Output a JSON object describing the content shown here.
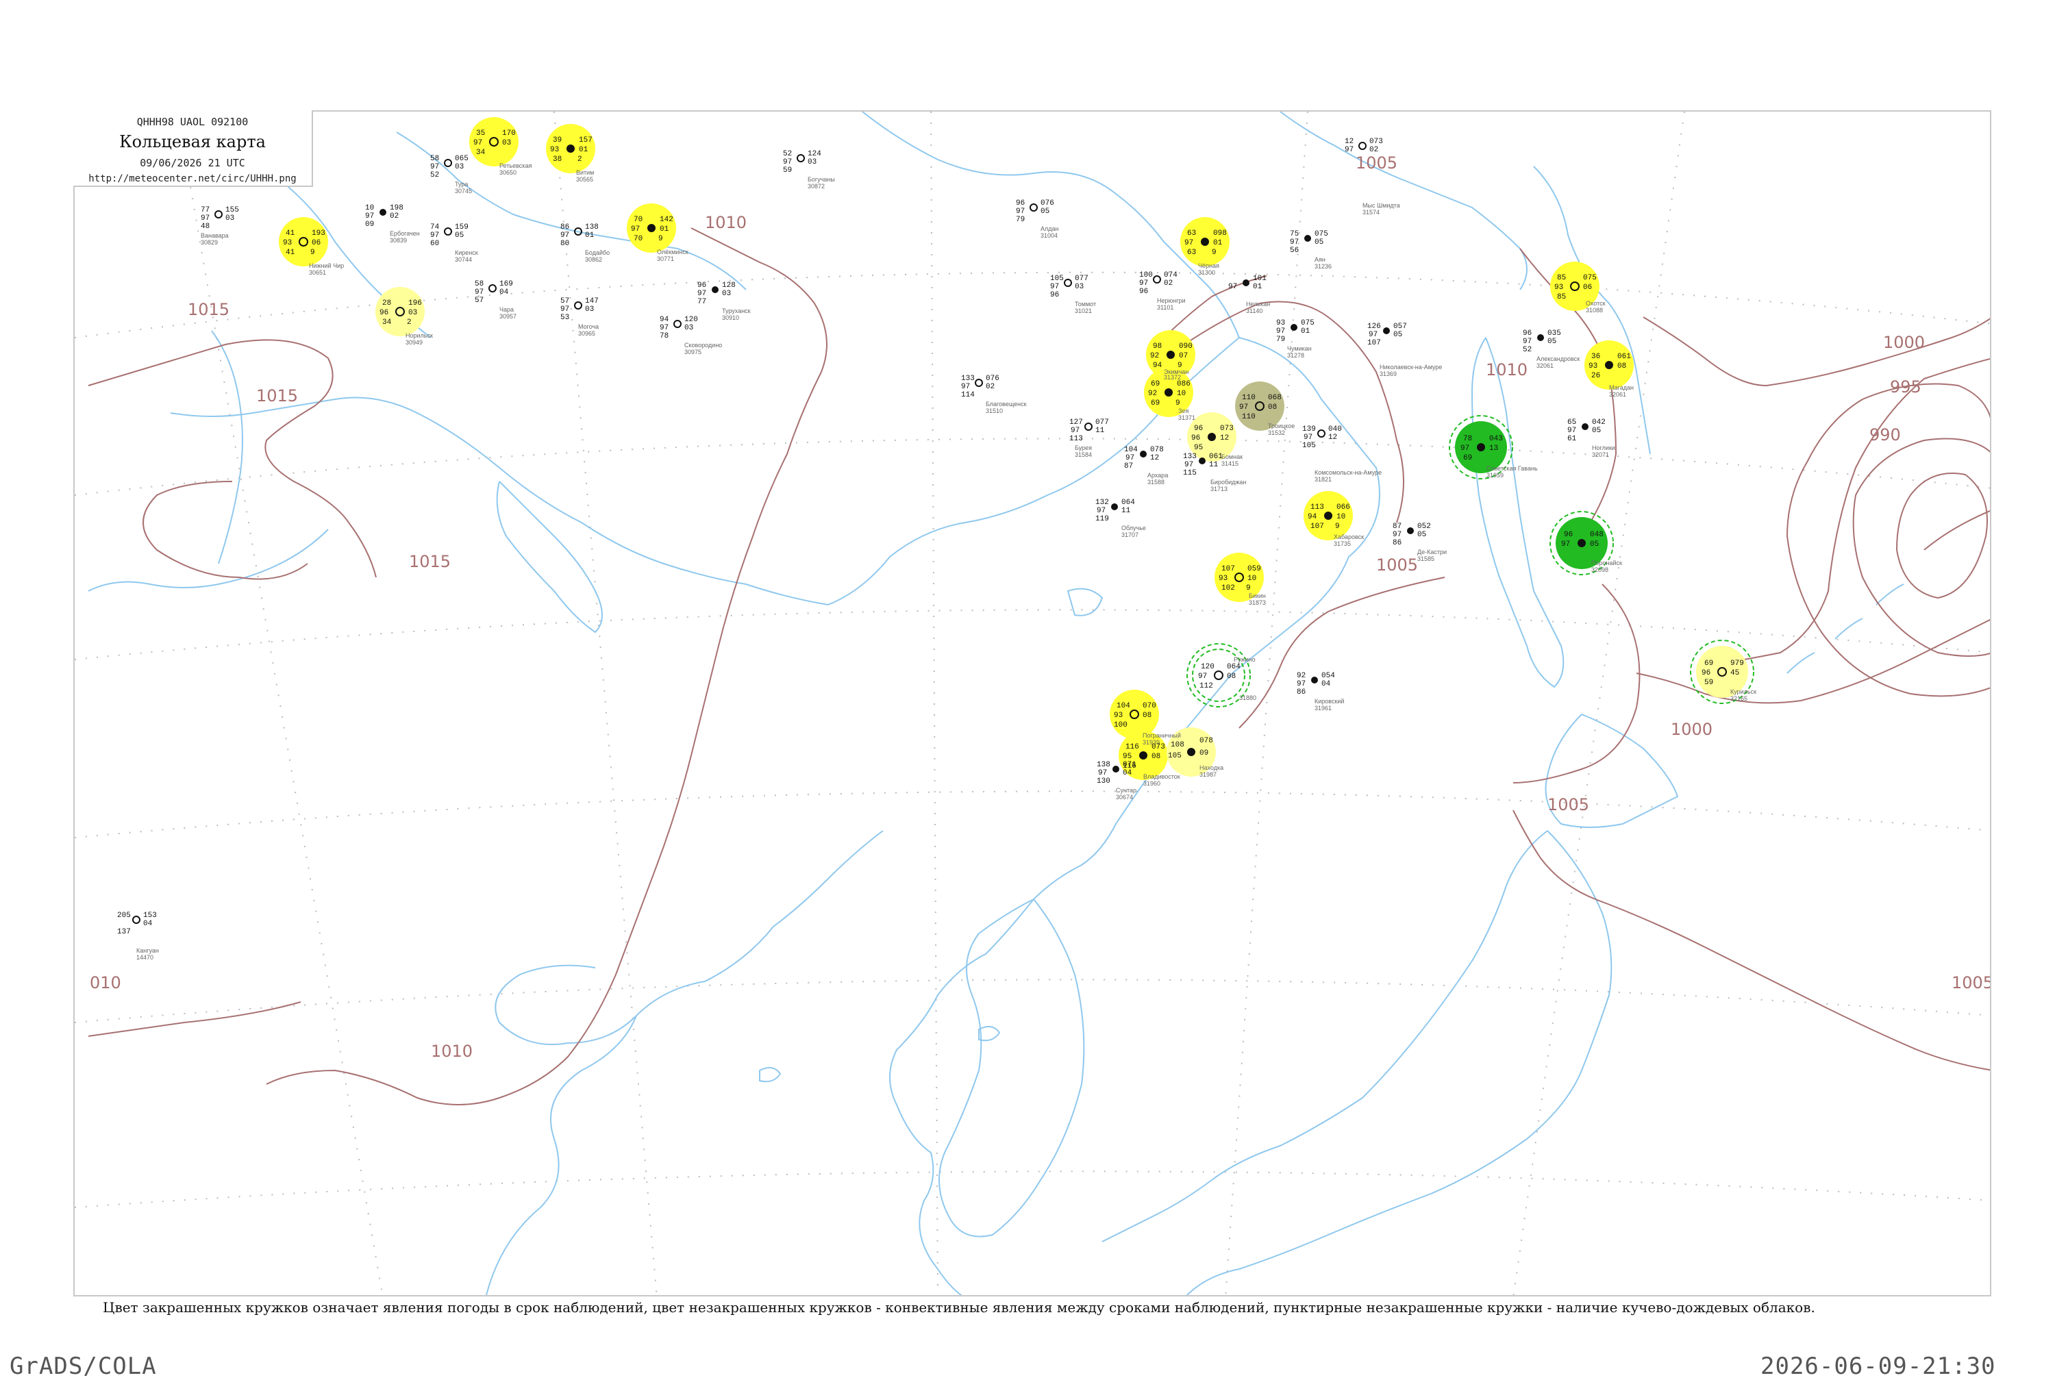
{
  "header": {
    "code": "QHHH98  UAOL  092100",
    "title": "Кольцевая карта",
    "datetime": "09/06/2026 21 UTC",
    "url": "http://meteocenter.net/circ/UHHH.png"
  },
  "caption": "Цвет закрашенных кружков означает явления погоды в срок наблюдений, цвет незакрашенных кружков - конвективные явления между сроками наблюдений, пунктирные незакрашенные кружки - наличие кучево-дождевых облаков.",
  "footer": {
    "left": "GrADS/COLA",
    "right": "2026-06-09-21:30"
  },
  "colors": {
    "coast": "#8fc8ee",
    "isobar": "#a87070",
    "grid": "#bbbbbb",
    "yellow": "#ffff33",
    "pale_yellow": "#ffff99",
    "green": "#22bb22",
    "olive": "#bdbd8a"
  },
  "isobar_labels": [
    "1015",
    "1015",
    "1015",
    "1010",
    "1010",
    "1005",
    "1005",
    "1005",
    "1005",
    "1000",
    "1000",
    "995",
    "990",
    "010",
    "1010"
  ],
  "stations": [
    {
      "name": "Ретьевская",
      "id": "30650",
      "values": [
        "35",
        "170",
        "97",
        "03",
        "34"
      ],
      "marker": "yellow"
    },
    {
      "name": "Витим",
      "id": "30565",
      "values": [
        "39",
        "157",
        "93",
        "01",
        "38",
        "2"
      ],
      "marker": "yellow"
    },
    {
      "name": "Олёкминск",
      "id": "30771",
      "values": [
        "70",
        "142",
        "97",
        "01",
        "70",
        "9"
      ],
      "marker": "yellow"
    },
    {
      "name": "Нижний Чир",
      "id": "30651",
      "values": [
        "41",
        "193",
        "93",
        "06",
        "41",
        "9"
      ],
      "marker": "yellow"
    },
    {
      "name": "Норильск",
      "id": "30949",
      "values": [
        "28",
        "196",
        "96",
        "03",
        "34",
        "2"
      ],
      "marker": "pale_yellow"
    },
    {
      "name": "Чёрная",
      "id": "31300",
      "values": [
        "63",
        "098",
        "97",
        "01",
        "63",
        "9"
      ],
      "marker": "yellow"
    },
    {
      "name": "Экимчан",
      "id": "31372",
      "values": [
        "98",
        "090",
        "92",
        "07",
        "94",
        "9"
      ],
      "marker": "yellow"
    },
    {
      "name": "Зея",
      "id": "31371",
      "values": [
        "69",
        "086",
        "92",
        "10",
        "69",
        "9"
      ],
      "marker": "yellow"
    },
    {
      "name": "Бомнак",
      "id": "31415",
      "values": [
        "96",
        "073",
        "96",
        "12",
        "95"
      ],
      "marker": "pale_yellow"
    },
    {
      "name": "Троицкое",
      "id": "31532",
      "values": [
        "110",
        "068",
        "97",
        "08",
        "110"
      ],
      "marker": "olive"
    },
    {
      "name": "Хабаровск",
      "id": "31735",
      "values": [
        "113",
        "066",
        "94",
        "10",
        "107",
        "9"
      ],
      "marker": "yellow"
    },
    {
      "name": "Бикин",
      "id": "31873",
      "values": [
        "107",
        "059",
        "93",
        "10",
        "102",
        "9"
      ],
      "marker": "yellow"
    },
    {
      "name": "Ружино",
      "id": "31880",
      "values": [
        "120",
        "064",
        "97",
        "08",
        "112"
      ],
      "marker": "green_ring"
    },
    {
      "name": "Пограничный",
      "id": "31939",
      "values": [
        "104",
        "070",
        "93",
        "08",
        "100"
      ],
      "marker": "yellow"
    },
    {
      "name": "Владивосток",
      "id": "31960",
      "values": [
        "116",
        "073",
        "95",
        "08",
        "116"
      ],
      "marker": "yellow"
    },
    {
      "name": "Находка",
      "id": "31987",
      "values": [
        "108",
        "078",
        "105",
        "09"
      ],
      "marker": "pale_yellow"
    },
    {
      "name": "Советская Гавань",
      "id": "31959",
      "values": [
        "78",
        "043",
        "97",
        "13",
        "69"
      ],
      "marker": "green"
    },
    {
      "name": "Охотск",
      "id": "31088",
      "values": [
        "85",
        "075",
        "93",
        "06",
        "85"
      ],
      "marker": "yellow"
    },
    {
      "name": "Магадан",
      "id": "32061",
      "values": [
        "36",
        "061",
        "93",
        "08",
        "26"
      ],
      "marker": "yellow"
    },
    {
      "name": "Поронайск",
      "id": "32098",
      "values": [
        "96",
        "048",
        "97",
        "05"
      ],
      "marker": "green"
    },
    {
      "name": "Курильск",
      "id": "32165",
      "values": [
        "69",
        "979",
        "96",
        "45",
        "59"
      ],
      "marker": "pale_yellow"
    },
    {
      "name": "Ванавара",
      "id": "30829",
      "values": [
        "77",
        "155",
        "97",
        "03",
        "48"
      ]
    },
    {
      "name": "Ербогачен",
      "id": "30839",
      "values": [
        "10",
        "198",
        "97",
        "02",
        "09"
      ]
    },
    {
      "name": "Тура",
      "id": "30745",
      "values": [
        "58",
        "065",
        "97",
        "03",
        "52"
      ]
    },
    {
      "name": "Киренск",
      "id": "30744",
      "values": [
        "74",
        "159",
        "97",
        "05",
        "60"
      ]
    },
    {
      "name": "Бодайбо",
      "id": "30862",
      "values": [
        "86",
        "138",
        "97",
        "01",
        "80"
      ]
    },
    {
      "name": "Чара",
      "id": "30957",
      "values": [
        "58",
        "169",
        "97",
        "04",
        "57"
      ]
    },
    {
      "name": "Сковородино",
      "id": "30975",
      "values": [
        "94",
        "120",
        "97",
        "03",
        "78"
      ]
    },
    {
      "name": "Могоча",
      "id": "30965",
      "values": [
        "57",
        "147",
        "97",
        "03",
        "53"
      ]
    },
    {
      "name": "Туруханск",
      "id": "30910",
      "values": [
        "96",
        "128",
        "97",
        "03",
        "77"
      ]
    },
    {
      "name": "Богучаны",
      "id": "30872",
      "values": [
        "52",
        "124",
        "97",
        "03",
        "59"
      ]
    },
    {
      "name": "Алдан",
      "id": "31004",
      "values": [
        "96",
        "076",
        "97",
        "05",
        "79"
      ]
    },
    {
      "name": "Томмот",
      "id": "31021",
      "values": [
        "105",
        "077",
        "97",
        "03",
        "96"
      ]
    },
    {
      "name": "Нерюнгри",
      "id": "31101",
      "values": [
        "100",
        "074",
        "97",
        "02",
        "96"
      ]
    },
    {
      "name": "Нелькан",
      "id": "31140",
      "values": [
        "101",
        "97",
        "01"
      ]
    },
    {
      "name": "Аян",
      "id": "31236",
      "values": [
        "75",
        "075",
        "97",
        "05",
        "56"
      ]
    },
    {
      "name": "Чумикан",
      "id": "31278",
      "values": [
        "93",
        "075",
        "97",
        "01",
        "79"
      ]
    },
    {
      "name": "Николаевск-на-Амуре",
      "id": "31369",
      "values": [
        "126",
        "057",
        "97",
        "05",
        "107"
      ]
    },
    {
      "name": "Де-Кастри",
      "id": "31585",
      "values": [
        "87",
        "052",
        "97",
        "05",
        "86"
      ]
    },
    {
      "name": "Александровск",
      "id": "32061",
      "values": [
        "96",
        "035",
        "97",
        "05",
        "52"
      ]
    },
    {
      "name": "Ноглики",
      "id": "32071",
      "values": [
        "65",
        "042",
        "97",
        "05",
        "61"
      ]
    },
    {
      "name": "Кировский",
      "id": "31961",
      "values": [
        "92",
        "054",
        "97",
        "04",
        "86"
      ]
    },
    {
      "name": "Мыс Шмидта",
      "id": "31574",
      "values": [
        "12",
        "073",
        "97",
        "02"
      ]
    },
    {
      "name": "Благовещенск",
      "id": "31510",
      "values": [
        "133",
        "076",
        "97",
        "02",
        "114"
      ]
    },
    {
      "name": "Облучье",
      "id": "31707",
      "values": [
        "132",
        "064",
        "97",
        "11",
        "119"
      ]
    },
    {
      "name": "Биробиджан",
      "id": "31713",
      "values": [
        "133",
        "061",
        "97",
        "11",
        "115"
      ]
    },
    {
      "name": "Комсомольск-на-Амуре",
      "id": "31821",
      "values": [
        "139",
        "040",
        "97",
        "12",
        "105"
      ]
    },
    {
      "name": "Бурея",
      "id": "31584",
      "values": [
        "127",
        "077",
        "97",
        "11",
        "113"
      ]
    },
    {
      "name": "Архара",
      "id": "31588",
      "values": [
        "104",
        "078",
        "97",
        "12",
        "87"
      ]
    },
    {
      "name": "Кангуан",
      "id": "14470",
      "values": [
        "205",
        "153",
        "04",
        "137"
      ]
    },
    {
      "name": "Сунтар",
      "id": "30674",
      "values": [
        "138",
        "071",
        "97",
        "04",
        "130"
      ]
    }
  ]
}
